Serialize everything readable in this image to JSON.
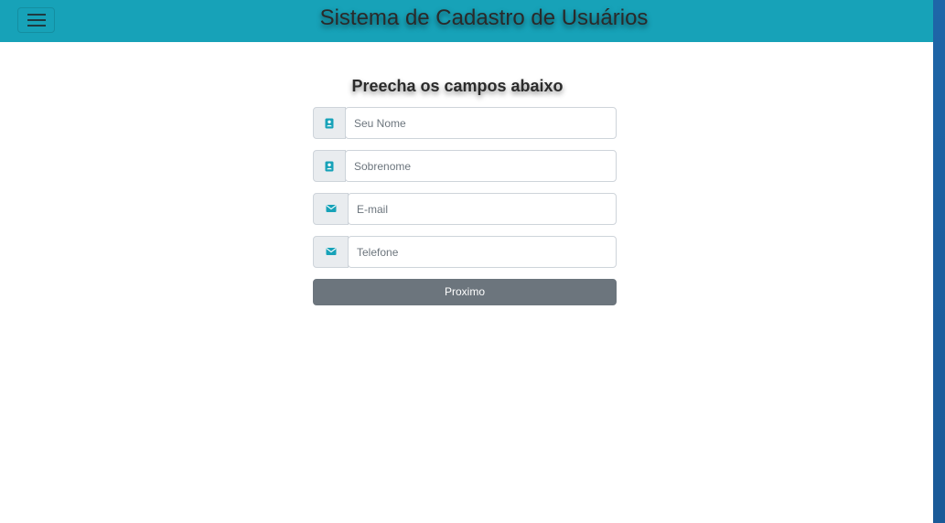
{
  "header": {
    "title": "Sistema de Cadastro de Usuários",
    "menu_icon": "hamburger-menu-icon",
    "background_color": "#17a2b8"
  },
  "form": {
    "title": "Preecha os campos abaixo",
    "fields": [
      {
        "placeholder": "Seu Nome",
        "value": "",
        "icon": "contact-card-icon"
      },
      {
        "placeholder": "Sobrenome",
        "value": "",
        "icon": "contact-card-icon"
      },
      {
        "placeholder": "E-mail",
        "value": "",
        "icon": "envelope-icon"
      },
      {
        "placeholder": "Telefone",
        "value": "",
        "icon": "envelope-icon"
      }
    ],
    "submit_label": "Proximo",
    "icon_color": "#17a2b8",
    "button_color": "#6c757d"
  }
}
